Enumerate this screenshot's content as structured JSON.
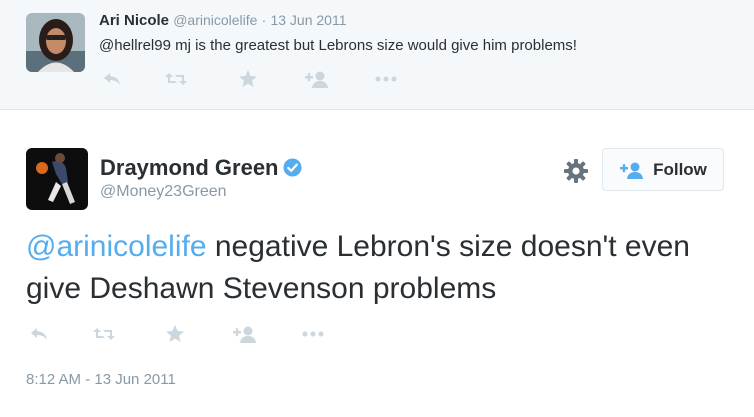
{
  "reply": {
    "name": "Ari Nicole",
    "handle": "@arinicolelife",
    "separator": "·",
    "date": "13 Jun 2011",
    "text": "@hellrel99 mj is the greatest but Lebrons size would give him problems!",
    "actions": [
      "reply-icon",
      "retweet-icon",
      "favorite-icon",
      "follow-icon",
      "more-icon"
    ]
  },
  "main": {
    "name": "Draymond Green",
    "verified": true,
    "handle": "@Money23Green",
    "follow_label": "Follow",
    "mention": "@arinicolelife",
    "text": " negative Lebron's size doesn't even give Deshawn Stevenson problems",
    "timestamp": "8:12 AM - 13 Jun 2011"
  },
  "colors": {
    "link": "#55acee",
    "muted": "#8899a6",
    "icon": "#ccd6dd",
    "reply_background": "#f5f8fa"
  }
}
